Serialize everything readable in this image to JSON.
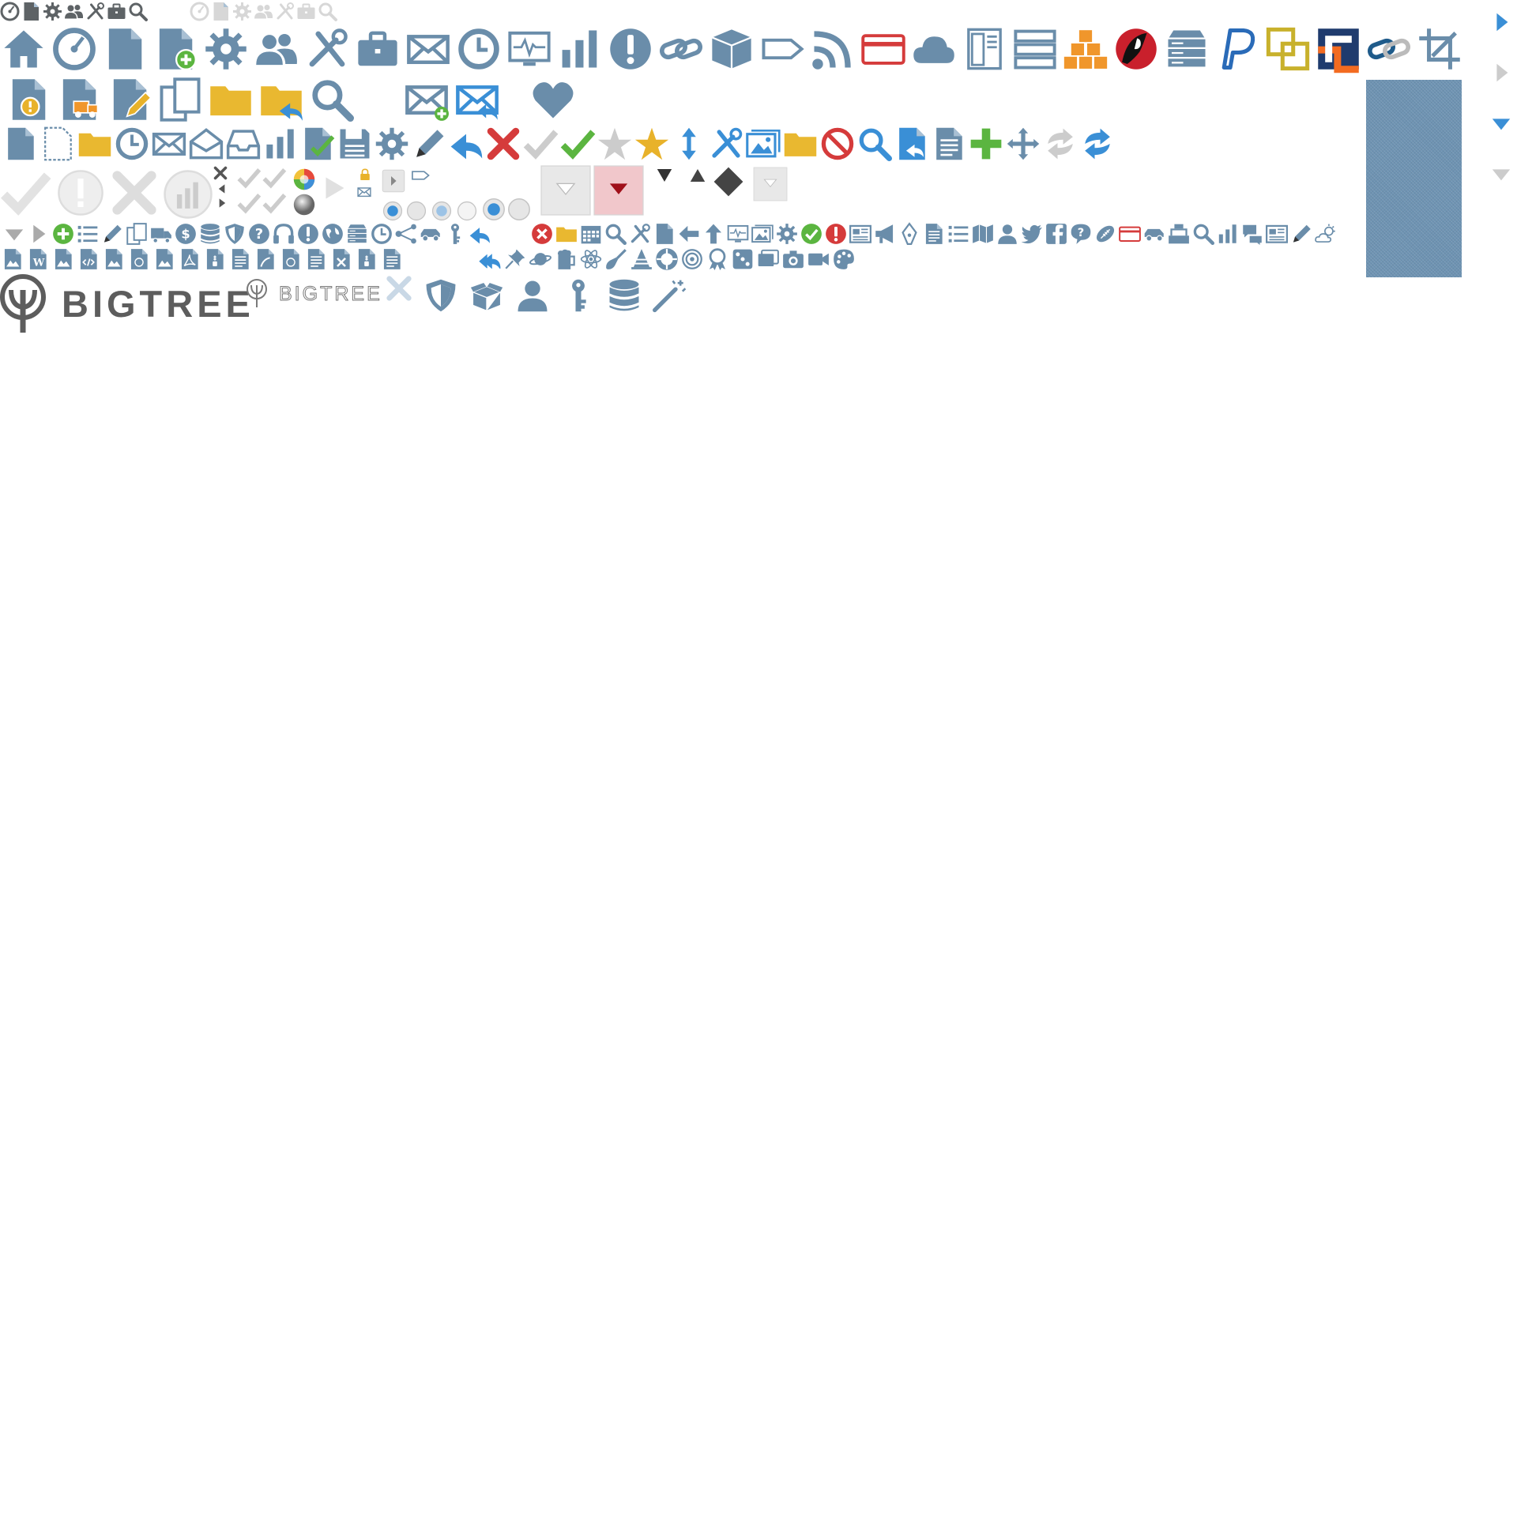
{
  "title": "",
  "logo": {
    "large_word": "BIGTREE",
    "small_word": "BIGTREE",
    "color": "#5d5d5d"
  },
  "palette": {
    "icon_blue": "#6a8daa",
    "icon_blue_dark": "#56779a",
    "folder_yellow": "#e9b830",
    "accent_blue": "#3a8fd6",
    "success_green": "#5bb540",
    "error_red": "#d53b3b",
    "star_gold": "#e8b22a",
    "orange": "#f0962b",
    "light_gray": "#d2d2d2",
    "dark_gray": "#5d5d5d",
    "texture_blue": "#6e93b2"
  },
  "sprite_rows": [
    {
      "name": "tiny-nav-icons",
      "icons": [
        "dashboard-icon",
        "pages-icon",
        "settings-icon",
        "users-icon",
        "developer-tools-icon",
        "briefcase-icon",
        "search-icon",
        "dashboard-icon-light",
        "pages-icon-light",
        "settings-icon-light",
        "users-icon-light",
        "developer-tools-icon-light",
        "briefcase-icon-light",
        "search-icon-light"
      ]
    },
    {
      "name": "large-section-icons",
      "icons": [
        "home-icon",
        "dashboard-icon",
        "page-icon",
        "add-page-icon",
        "gear-icon",
        "users-icon",
        "tools-icon",
        "briefcase-icon",
        "mail-icon",
        "clock-icon",
        "analytics-monitor-icon",
        "bar-chart-icon",
        "alert-icon",
        "link-icon",
        "package-icon",
        "tag-icon",
        "rss-icon",
        "credit-card-icon",
        "cloud-icon",
        "document-column-icon",
        "list-rows-icon",
        "boxes-icon",
        "rackspace-logo-icon",
        "server-icon",
        "paypal-logo-icon",
        "overlapping-squares-icon",
        "authorize-logo-icon",
        "chain-link-icon",
        "crop-icon"
      ]
    },
    {
      "name": "large-page-icons",
      "icons": [
        "page-alert-icon",
        "page-move-icon",
        "page-edit-icon",
        "copy-pages-icon",
        "folder-icon",
        "folder-return-icon",
        "search-icon",
        "mail-add-icon",
        "mail-reply-icon",
        "heart-icon"
      ]
    },
    {
      "name": "medium-action-icons",
      "icons": [
        "page-icon",
        "new-page-icon",
        "folder-icon",
        "clock-icon",
        "mail-icon",
        "open-mail-icon",
        "inbox-icon",
        "bar-chart-icon",
        "page-check-icon",
        "save-icon",
        "gear-icon",
        "pencil-icon",
        "reply-icon",
        "delete-x-icon",
        "check-gray-icon",
        "check-green-icon",
        "star-gray-icon",
        "star-gold-icon",
        "sort-arrows-icon",
        "tools-blue-icon",
        "photos-icon",
        "folder-yellow-icon",
        "no-entry-icon",
        "page-search-icon",
        "page-reply-icon",
        "document-icon",
        "plus-green-icon",
        "move-icon",
        "refresh-gray-icon",
        "refresh-blue-icon"
      ]
    },
    {
      "name": "form-controls",
      "icons": [
        "check-light-icon",
        "alert-circle-light-icon",
        "x-light-icon",
        "chart-circle-light-icon",
        "tiny-x-icon",
        "tiny-arrow-left-icon",
        "tiny-arrow-right-icon",
        "checkbox-off",
        "checkbox-off",
        "checkbox-on",
        "checkbox-on",
        "color-wheel-icon",
        "gray-sphere-icon",
        "play-triangle-icon",
        "lock-icon",
        "mail-small-icon",
        "arrow-button",
        "tag-icon",
        "radio-on",
        "radio-off",
        "radio-hover",
        "radio-light",
        "radio-on-large",
        "radio-off-large",
        "select-arrow-normal",
        "select-arrow-active",
        "dropdown-caret-down",
        "dropdown-caret-up",
        "dropdown-diamond",
        "select-arrow-small"
      ]
    },
    {
      "name": "small-toolbar-icons",
      "icons": [
        "caret-down-icon",
        "caret-right-icon",
        "plus-circle-icon",
        "list-icon",
        "pencil-icon",
        "copy-icon",
        "truck-icon",
        "dollar-icon",
        "database-icon",
        "shield-icon",
        "help-icon",
        "headphones-icon",
        "alert-icon",
        "globe-icon",
        "server-icon",
        "alarm-icon",
        "share-icon",
        "car-icon",
        "key-icon",
        "reply-icon",
        "delete-circle-icon",
        "folder-icon",
        "calendar-icon",
        "search-icon",
        "tools-icon",
        "page-icon",
        "arrow-left-icon",
        "arrow-up-icon",
        "monitor-icon",
        "image-icon",
        "gears-icon",
        "check-circle-icon",
        "alert-circle-icon",
        "newspaper-icon",
        "megaphone-icon",
        "pen-nib-icon",
        "document-list-icon",
        "bullet-list-icon",
        "map-icon",
        "person-icon",
        "twitter-icon",
        "facebook-icon",
        "question-bubble-icon",
        "football-icon",
        "credit-card-icon",
        "cart-icon",
        "cash-register-icon",
        "magnifier-icon",
        "bar-chart-icon",
        "chat-icon",
        "news-icon",
        "pencil-icon",
        "weather-icon"
      ]
    },
    {
      "name": "small-file-icons",
      "icons": [
        "file-image-icon",
        "file-word-icon",
        "file-image-icon",
        "file-code-icon",
        "file-image-icon",
        "file-video-icon",
        "file-image-icon",
        "file-pdf-icon",
        "file-zip-icon",
        "file-text-icon",
        "file-flash-icon",
        "file-media-icon",
        "file-text-icon",
        "file-excel-icon",
        "file-archive-icon",
        "file-text-icon",
        "reply-all-icon",
        "pin-icon",
        "planet-icon",
        "beer-icon",
        "atom-icon",
        "shovel-icon",
        "cone-icon",
        "lifebuoy-icon",
        "target-icon",
        "award-icon",
        "dice-icon",
        "cards-icon",
        "camera-icon",
        "video-icon",
        "palette-icon"
      ]
    },
    {
      "name": "logo-row",
      "icons": [
        "bigtree-logo",
        "bigtree-logo-outline",
        "close-light-icon",
        "shield-icon",
        "open-box-icon",
        "person-icon",
        "key-icon",
        "database-icon",
        "magic-wand-icon"
      ]
    },
    {
      "name": "right-edge-arrows",
      "icons": [
        "arrow-right-blue-icon",
        "arrow-right-gray-icon",
        "arrow-down-blue-icon",
        "arrow-down-gray-icon"
      ]
    }
  ]
}
